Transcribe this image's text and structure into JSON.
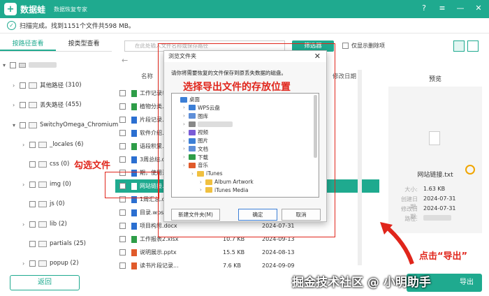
{
  "app": {
    "logo_glyph": "+",
    "name": "数据蛙",
    "subtitle": "数据恢复专家",
    "accent": "#1faa8f"
  },
  "window_controls": {
    "help": "?",
    "menu": "≡",
    "minimize": "—",
    "close": "✕"
  },
  "status": {
    "text": "扫描完成。找到1151个文件共598 MB。"
  },
  "left_tabs": [
    "按路径查看",
    "按类型查看"
  ],
  "tree": [
    {
      "label": "",
      "count": ""
    },
    {
      "label": "其他路径",
      "count": "(310)"
    },
    {
      "label": "丢失路径",
      "count": "(455)"
    },
    {
      "label": "SwitchyOmega_Chromium",
      "count": ""
    },
    {
      "label": "_locales",
      "count": "(6)"
    },
    {
      "label": "css",
      "count": "(0)"
    },
    {
      "label": "img",
      "count": "(0)"
    },
    {
      "label": "js",
      "count": "(0)"
    },
    {
      "label": "lib",
      "count": "(2)"
    },
    {
      "label": "partials",
      "count": "(25)"
    },
    {
      "label": "popup",
      "count": "(2)"
    }
  ],
  "back_button": "返回",
  "toolbar": {
    "search_placeholder": "在此处输入文件名称或保存路径",
    "filter_button": "筛选器",
    "only_deleted": "仅显示删除项"
  },
  "nav": {
    "back": "←"
  },
  "file_headers": {
    "name": "名称",
    "size": "",
    "date": "修改日期"
  },
  "files": [
    {
      "name": "工作记录表",
      "size": "",
      "date": "2024-08-07",
      "color": "#2e9d48"
    },
    {
      "name": "植物分类.",
      "size": "",
      "date": "2024-08-06",
      "color": "#2e9d48"
    },
    {
      "name": "片段记录.",
      "size": "",
      "date": "2024-08-09",
      "color": "#2b6fd1"
    },
    {
      "name": "软件介绍.",
      "size": "",
      "date": "2024-09-11",
      "color": "#2b6fd1"
    },
    {
      "name": "语段积累.",
      "size": "",
      "date": "2024-07-26",
      "color": "#2e9d48"
    },
    {
      "name": "3周总结.d",
      "size": "",
      "date": "2024-07-02",
      "color": "#2b6fd1"
    },
    {
      "name": "期，使用注",
      "size": "",
      "date": "2024-07-04",
      "color": "#2b6fd1"
    },
    {
      "name": "网站链接.tx",
      "size": "",
      "date": "2024-07-31",
      "color": "#ffffff"
    },
    {
      "name": "1周汇总.d",
      "size": "",
      "date": "2024-07-02",
      "color": "#2b6fd1"
    },
    {
      "name": "目录.wps",
      "size": "",
      "date": "2024-09-11",
      "color": "#2b6fd1"
    },
    {
      "name": "项目构思.docx",
      "size": "",
      "date": "2024-07-31",
      "color": "#2b6fd1"
    },
    {
      "name": "工作报表2.xlsx",
      "size": "10.7 KB",
      "date": "2024-09-13",
      "color": "#2e9d48"
    },
    {
      "name": "说明展示.pptx",
      "size": "15.5 KB",
      "date": "2024-08-13",
      "color": "#e05a2b"
    },
    {
      "name": "读书片段记录...",
      "size": "7.6 KB",
      "date": "2024-09-09",
      "color": "#e05a2b"
    }
  ],
  "preview": {
    "title": "预览",
    "filename": "网站链接.txt",
    "size_label": "大小:",
    "size": "1.63 KB",
    "created_label": "创建日期:",
    "created": "2024-07-31",
    "modified_label": "修改日期:",
    "modified": "2024-07-31",
    "path_label": "路径:"
  },
  "export_button": "导出",
  "dialog": {
    "title": "浏览文件夹",
    "close": "✕",
    "message": "请你将需要恢复的文件保存到原丢失数据的磁盘。",
    "tree": [
      {
        "label": "桌面",
        "indent": 0,
        "color": "#3c7fd6"
      },
      {
        "label": "WPS云盘",
        "indent": 1,
        "color": "#3c7fd6"
      },
      {
        "label": "图库",
        "indent": 1,
        "color": "#5f8fd8"
      },
      {
        "label": "",
        "indent": 1,
        "color": "#888888"
      },
      {
        "label": "视频",
        "indent": 1,
        "color": "#7a5bd6"
      },
      {
        "label": "图片",
        "indent": 1,
        "color": "#3c7fd6"
      },
      {
        "label": "文档",
        "indent": 1,
        "color": "#5f8fd8"
      },
      {
        "label": "下载",
        "indent": 1,
        "color": "#2e9d48"
      },
      {
        "label": "音乐",
        "indent": 1,
        "color": "#e05a2b"
      },
      {
        "label": "iTunes",
        "indent": 2,
        "color": "#f0c040"
      },
      {
        "label": "Album Artwork",
        "indent": 3,
        "color": "#f0c040"
      },
      {
        "label": "iTunes Media",
        "indent": 3,
        "color": "#f0c040"
      }
    ],
    "new_folder": "新建文件夹(M)",
    "ok": "确定",
    "cancel": "取消"
  },
  "annotations": {
    "dialog_hint": "选择导出文件的存放位置",
    "check_hint": "勾选文件",
    "export_hint": "点击“导出”",
    "color": "#e0251b"
  },
  "watermark": "掘金技术社区 @ 小明助手"
}
